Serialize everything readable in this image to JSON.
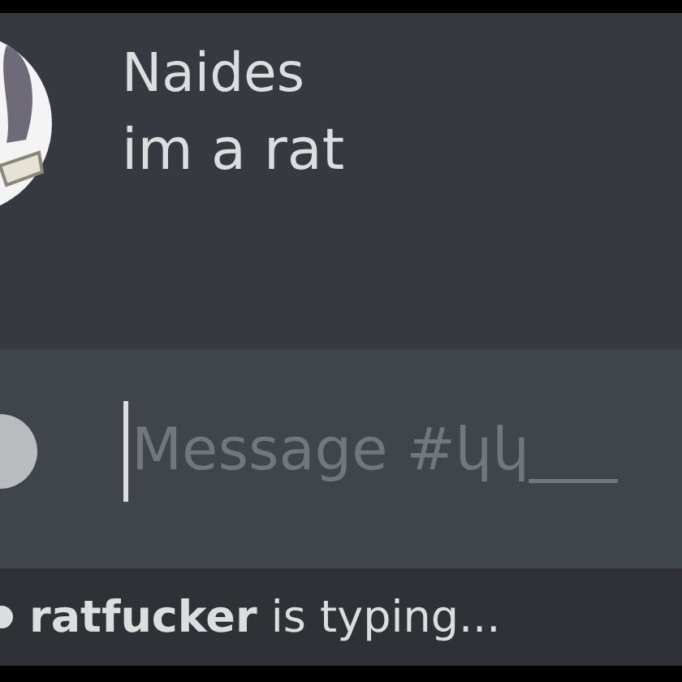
{
  "message": {
    "author": "Naides",
    "text": "im a rat"
  },
  "composer": {
    "placeholder": "Message #կկ___"
  },
  "typing_indicator": "**ratfucker** is typing..."
}
